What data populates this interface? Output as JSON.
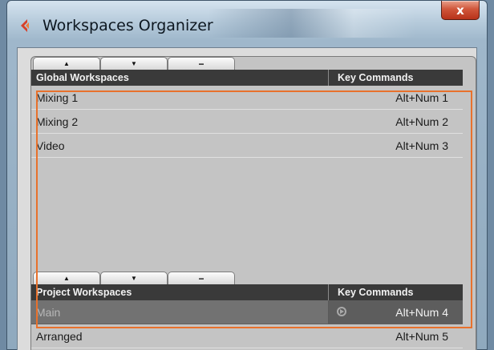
{
  "window": {
    "title": "Workspaces Organizer",
    "close_label": "x"
  },
  "global": {
    "toolbar": {
      "up": "▲",
      "down": "▼",
      "remove": "−"
    },
    "header": {
      "name_col": "Global Workspaces",
      "key_col": "Key Commands"
    },
    "rows": [
      {
        "name": "Mixing 1",
        "key": "Alt+Num 1"
      },
      {
        "name": "Mixing 2",
        "key": "Alt+Num 2"
      },
      {
        "name": "Video",
        "key": "Alt+Num 3"
      }
    ]
  },
  "project": {
    "toolbar": {
      "up": "▲",
      "down": "▼",
      "remove": "−"
    },
    "header": {
      "name_col": "Project Workspaces",
      "key_col": "Key Commands"
    },
    "rows": [
      {
        "name": "Main",
        "key": "Alt+Num 4",
        "selected": true
      },
      {
        "name": "Arranged",
        "key": "Alt+Num 5"
      }
    ]
  },
  "colors": {
    "highlight": "#e8712c",
    "header_bg": "#3a3a3a",
    "selected_row": "#727272"
  },
  "icons": [
    "cubase-app-icon",
    "close-icon",
    "move-up-icon",
    "move-down-icon",
    "remove-icon",
    "play-icon"
  ]
}
